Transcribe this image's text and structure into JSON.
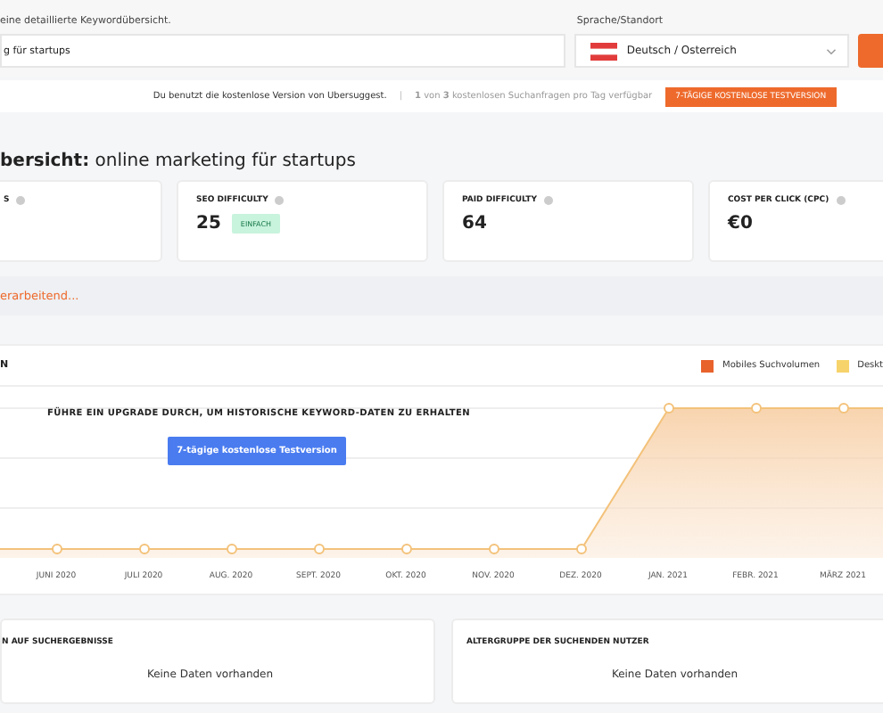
{
  "search": {
    "label": "eine detaillierte Keywordübersicht.",
    "value": "g für startups"
  },
  "locale": {
    "label": "Sprache/Standort",
    "value": "Deutsch / Osterreich"
  },
  "notice": {
    "text": "Du benutzt die kostenlose Version von Ubersuggest.",
    "separator": "|",
    "quota": "**1** von **3** kostenlosen Suchanfragen pro Tag verfügbar",
    "button": "7-TÄGIGE KOSTENLOSE TESTVERSION"
  },
  "heading": "**bersicht:** online marketing für startups",
  "metrics": [
    {
      "label": "S"
    },
    {
      "label": "SEO DIFFICULTY",
      "value": "25",
      "badge": "EINFACH"
    },
    {
      "label": "PAID DIFFICULTY",
      "value": "64"
    },
    {
      "label": "COST PER CLICK (CPC)",
      "value": "€0"
    }
  ],
  "status": "erarbeitend...",
  "trend": {
    "title": "N",
    "legend": [
      {
        "label": "Mobiles Suchvolumen",
        "color": "#e8622c"
      },
      {
        "label": "Deskt",
        "color": "#f7d36b"
      }
    ],
    "upgrade_text": "FÜHRE EIN UPGRADE DURCH, UM HISTORISCHE KEYWORD-DATEN ZU ERHALTEN",
    "upgrade_button": "7-tägige kostenlose Testversion",
    "months": [
      "JUNI 2020",
      "JULI 2020",
      "AUG. 2020",
      "SEPT. 2020",
      "OKT. 2020",
      "NOV. 2020",
      "DEZ. 2020",
      "JAN. 2021",
      "FEBR. 2021",
      "MÄRZ 2021"
    ]
  },
  "panels": [
    {
      "title": "N AUF SUCHERGEBNISSE",
      "text": "Keine Daten vorhanden"
    },
    {
      "title": "ALTERGRUPPE DER SUCHENDEN NUTZER",
      "text": "Keine Daten vorhanden"
    }
  ]
}
